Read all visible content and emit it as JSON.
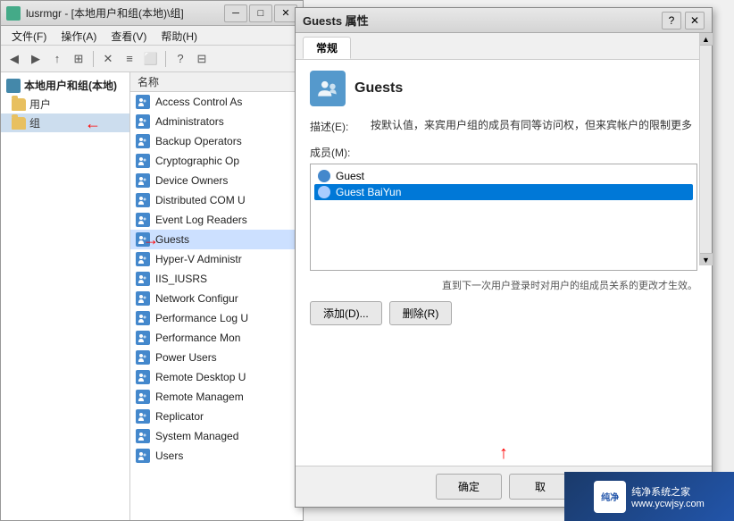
{
  "mainWindow": {
    "title": "lusrmgr - [本地用户和组(本地)\\组]",
    "menus": [
      "文件(F)",
      "操作(A)",
      "查看(V)",
      "帮助(H)"
    ],
    "sidebar": {
      "rootLabel": "本地用户和组(本地)",
      "items": [
        {
          "label": "用户",
          "icon": "folder"
        },
        {
          "label": "组",
          "icon": "folder"
        }
      ]
    },
    "listHeader": "名称",
    "listItems": [
      "Access Control As",
      "Administrators",
      "Backup Operators",
      "Cryptographic Op",
      "Device Owners",
      "Distributed COM U",
      "Event Log Readers",
      "Guests",
      "Hyper-V Administr",
      "IIS_IUSRS",
      "Network Configur",
      "Performance Log U",
      "Performance Mon",
      "Power Users",
      "Remote Desktop U",
      "Remote Managem",
      "Replicator",
      "System Managed",
      "Users"
    ],
    "selectedItem": "Guests"
  },
  "dialog": {
    "title": "Guests 属性",
    "helpBtn": "?",
    "closeBtn": "✕",
    "tabs": [
      "常规"
    ],
    "groupName": "Guests",
    "descriptionLabel": "描述(E):",
    "descriptionValue": "按默认值，来宾用户组的成员有同等访问权，但来宾帐户的限制更多",
    "membersLabel": "成员(M):",
    "members": [
      {
        "name": "Guest",
        "selected": false
      },
      {
        "name": "Guest BaiYun",
        "selected": true
      }
    ],
    "noteText": "直到下一次用户登录时对用户的组成员关系的更改才生效。",
    "addBtn": "添加(D)...",
    "removeBtn": "删除(R)",
    "confirmBtn": "确定",
    "cancelBtn": "取",
    "scrollUpBtn": "▲",
    "scrollDownBtn": "▼"
  },
  "branding": {
    "logoText": "纯净",
    "line1": "纯净系统之家",
    "line2": "www.ycwjsy.com"
  }
}
